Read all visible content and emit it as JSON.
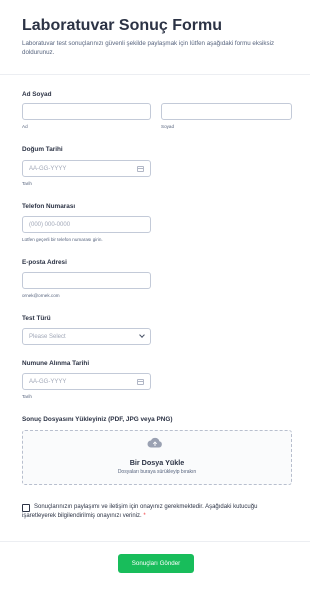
{
  "form": {
    "title": "Laboratuvar Sonuç Formu",
    "subtitle": "Laboratuvar test sonuçlarınızı güvenli şekilde paylaşmak için lütfen aşağıdaki formu eksiksiz doldurunuz."
  },
  "name": {
    "label": "Ad Soyad",
    "first_sub": "Ad",
    "last_sub": "Soyad"
  },
  "birth_date": {
    "label": "Doğum Tarihi",
    "placeholder": "AA-GG-YYYY",
    "sub": "Tarih",
    "icon": "calendar-icon"
  },
  "phone": {
    "label": "Telefon Numarası",
    "placeholder": "(000) 000-0000",
    "sub": "Lütfen geçerli bir telefon numarası girin."
  },
  "email": {
    "label": "E-posta Adresi",
    "sub": "ornek@ornek.com"
  },
  "test_type": {
    "label": "Test Türü",
    "placeholder": "Please Select",
    "icon": "chevron-down-icon"
  },
  "sample_date": {
    "label": "Numune Alınma Tarihi",
    "placeholder": "AA-GG-YYYY",
    "sub": "Tarih",
    "icon": "calendar-icon"
  },
  "upload": {
    "label": "Sonuç Dosyasını Yükleyiniz (PDF, JPG veya PNG)",
    "title": "Bir Dosya Yükle",
    "sub": "Dosyaları buraya sürükleyip bırakın",
    "icon": "cloud-upload-icon"
  },
  "consent": {
    "text": "Sonuçlarınızın paylaşımı ve iletişim için onayınız gerekmektedir. Aşağıdaki kutucuğu işaretleyerek bilgilendirilmiş onayınızı veriniz.",
    "required_mark": "*"
  },
  "submit": {
    "label": "Sonuçları Gönder",
    "color": "#18bd5b"
  }
}
